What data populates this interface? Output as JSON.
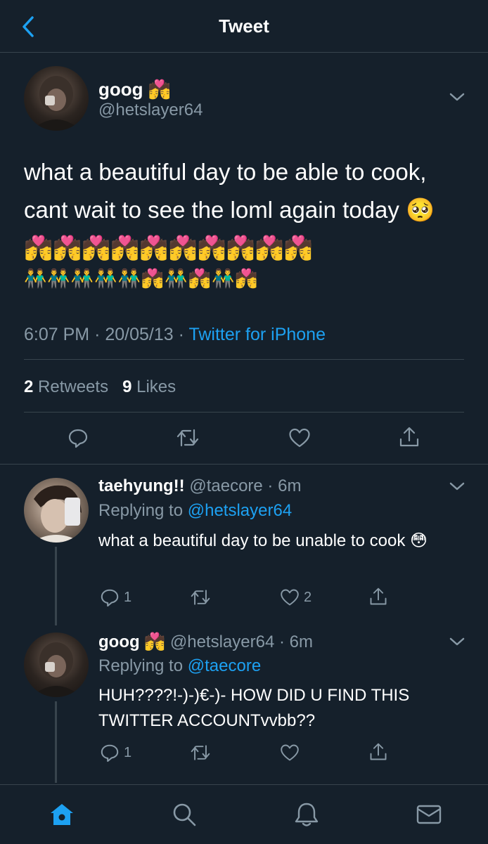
{
  "header": {
    "title": "Tweet"
  },
  "main_tweet": {
    "name": "goog 💏",
    "handle": "@hetslayer64",
    "text": "what a beautiful day to be able to cook, cant wait to see the loml again today 🥺💏💏💏💏💏💏💏💏💏💏",
    "emoji_line": "👬👬👬👬👬💏👬💏👬💏",
    "time": "6:07 PM",
    "date": "20/05/13",
    "source": "Twitter for iPhone",
    "retweets_count": "2",
    "retweets_label": "Retweets",
    "likes_count": "9",
    "likes_label": "Likes"
  },
  "replies": [
    {
      "name": "taehyung!!",
      "handle": "@taecore",
      "time": "6m",
      "replying_label": "Replying to",
      "replying_to": "@hetslayer64",
      "text": "what a beautiful day to be unable to cook 😳",
      "reply_count": "1",
      "like_count": "2"
    },
    {
      "name": "goog 💏",
      "handle": "@hetslayer64",
      "time": "6m",
      "replying_label": "Replying to",
      "replying_to": "@taecore",
      "text": "HUH????!-)-)€-)- HOW DID U FIND THIS TWITTER ACCOUNTvvbb??",
      "reply_count": "1",
      "like_count": ""
    }
  ],
  "colors": {
    "background": "#15202b",
    "accent": "#1da1f2",
    "muted": "#8899a6",
    "border": "#38444d"
  },
  "icons": [
    "back-arrow-icon",
    "chevron-down-icon",
    "reply-icon",
    "retweet-icon",
    "like-icon",
    "share-icon",
    "home-icon",
    "search-icon",
    "notifications-icon",
    "messages-icon"
  ]
}
